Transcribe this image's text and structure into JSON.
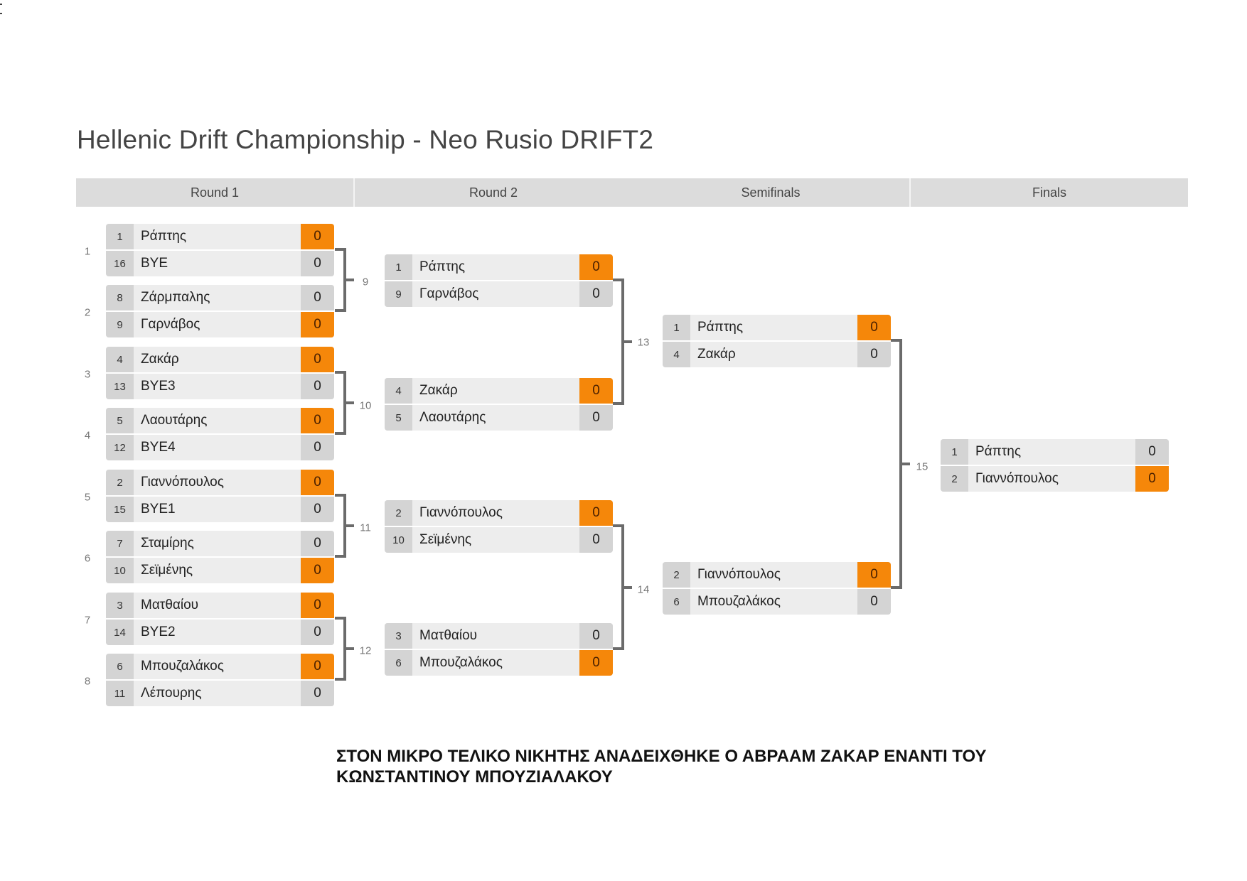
{
  "title": "Hellenic Drift Championship - Neo Rusio DRIFT2",
  "rounds": [
    "Round 1",
    "Round 2",
    "Semifinals",
    "Finals"
  ],
  "colors": {
    "winner": "#f5870a",
    "cell": "#d4d4d4",
    "name_bg": "#ededed",
    "connector": "#6b6b6b"
  },
  "matches": [
    {
      "id": "1",
      "round": 1,
      "players": [
        {
          "seed": "1",
          "name": "Ράπτης",
          "score": "0",
          "winner": true
        },
        {
          "seed": "16",
          "name": "BYE",
          "score": "0",
          "winner": false
        }
      ]
    },
    {
      "id": "2",
      "round": 1,
      "players": [
        {
          "seed": "8",
          "name": "Ζάρμπαλης",
          "score": "0",
          "winner": false
        },
        {
          "seed": "9",
          "name": "Γαρνάβος",
          "score": "0",
          "winner": true
        }
      ]
    },
    {
      "id": "3",
      "round": 1,
      "players": [
        {
          "seed": "4",
          "name": "Ζακάρ",
          "score": "0",
          "winner": true
        },
        {
          "seed": "13",
          "name": "BYE3",
          "score": "0",
          "winner": false
        }
      ]
    },
    {
      "id": "4",
      "round": 1,
      "players": [
        {
          "seed": "5",
          "name": "Λαουτάρης",
          "score": "0",
          "winner": true
        },
        {
          "seed": "12",
          "name": "BYE4",
          "score": "0",
          "winner": false
        }
      ]
    },
    {
      "id": "5",
      "round": 1,
      "players": [
        {
          "seed": "2",
          "name": "Γιαννόπουλος",
          "score": "0",
          "winner": true
        },
        {
          "seed": "15",
          "name": "BYE1",
          "score": "0",
          "winner": false
        }
      ]
    },
    {
      "id": "6",
      "round": 1,
      "players": [
        {
          "seed": "7",
          "name": "Σταμίρης",
          "score": "0",
          "winner": false
        },
        {
          "seed": "10",
          "name": "Σεϊμένης",
          "score": "0",
          "winner": true
        }
      ]
    },
    {
      "id": "7",
      "round": 1,
      "players": [
        {
          "seed": "3",
          "name": "Ματθαίου",
          "score": "0",
          "winner": true
        },
        {
          "seed": "14",
          "name": "BYE2",
          "score": "0",
          "winner": false
        }
      ]
    },
    {
      "id": "8",
      "round": 1,
      "players": [
        {
          "seed": "6",
          "name": "Μπουζαλάκος",
          "score": "0",
          "winner": true
        },
        {
          "seed": "11",
          "name": "Λέπουρης",
          "score": "0",
          "winner": false
        }
      ]
    },
    {
      "id": "9",
      "round": 2,
      "players": [
        {
          "seed": "1",
          "name": "Ράπτης",
          "score": "0",
          "winner": true
        },
        {
          "seed": "9",
          "name": "Γαρνάβος",
          "score": "0",
          "winner": false
        }
      ]
    },
    {
      "id": "10",
      "round": 2,
      "players": [
        {
          "seed": "4",
          "name": "Ζακάρ",
          "score": "0",
          "winner": true
        },
        {
          "seed": "5",
          "name": "Λαουτάρης",
          "score": "0",
          "winner": false
        }
      ]
    },
    {
      "id": "11",
      "round": 2,
      "players": [
        {
          "seed": "2",
          "name": "Γιαννόπουλος",
          "score": "0",
          "winner": true
        },
        {
          "seed": "10",
          "name": "Σεϊμένης",
          "score": "0",
          "winner": false
        }
      ]
    },
    {
      "id": "12",
      "round": 2,
      "players": [
        {
          "seed": "3",
          "name": "Ματθαίου",
          "score": "0",
          "winner": false
        },
        {
          "seed": "6",
          "name": "Μπουζαλάκος",
          "score": "0",
          "winner": true
        }
      ]
    },
    {
      "id": "13",
      "round": 3,
      "players": [
        {
          "seed": "1",
          "name": "Ράπτης",
          "score": "0",
          "winner": true
        },
        {
          "seed": "4",
          "name": "Ζακάρ",
          "score": "0",
          "winner": false
        }
      ]
    },
    {
      "id": "14",
      "round": 3,
      "players": [
        {
          "seed": "2",
          "name": "Γιαννόπουλος",
          "score": "0",
          "winner": true
        },
        {
          "seed": "6",
          "name": "Μπουζαλάκος",
          "score": "0",
          "winner": false
        }
      ]
    },
    {
      "id": "15",
      "round": 4,
      "players": [
        {
          "seed": "1",
          "name": "Ράπτης",
          "score": "0",
          "winner": false
        },
        {
          "seed": "2",
          "name": "Γιαννόπουλος",
          "score": "0",
          "winner": true
        }
      ]
    }
  ],
  "footer": {
    "line1": "ΣΤΟΝ ΜΙΚΡΟ ΤΕΛΙΚΟ ΝΙΚΗΤΗΣ ΑΝΑΔΕΙΧΘΗΚΕ Ο ΑΒΡΑΑΜ ΖΑΚΑΡ ΕΝΑΝΤΙ ΤΟΥ",
    "line2": "ΚΩΝΣΤΑΝΤΙΝΟΥ ΜΠΟΥΖΙΑΛΑΚΟΥ"
  }
}
